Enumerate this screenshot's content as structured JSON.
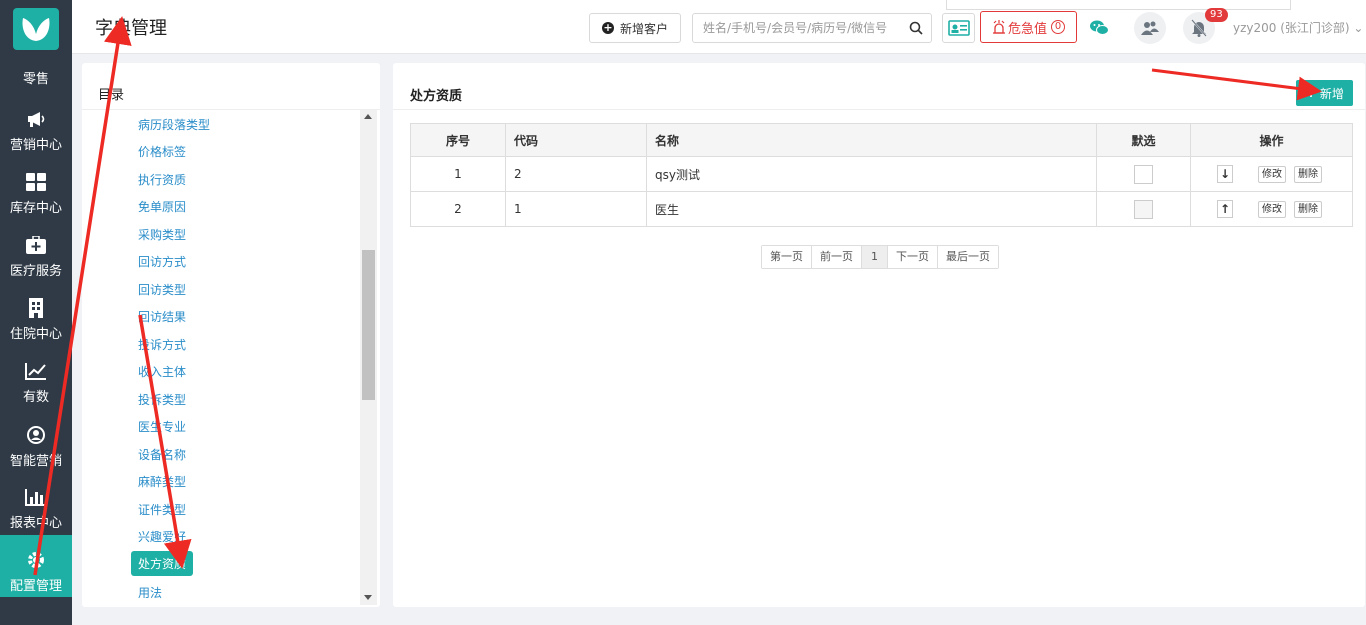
{
  "sidebar": {
    "items": [
      {
        "label": "零售",
        "icon": "retail-icon"
      },
      {
        "label": "营销中心",
        "icon": "megaphone-icon"
      },
      {
        "label": "库存中心",
        "icon": "grid-icon"
      },
      {
        "label": "医疗服务",
        "icon": "medical-kit-icon"
      },
      {
        "label": "住院中心",
        "icon": "hospital-icon"
      },
      {
        "label": "有数",
        "icon": "trend-icon"
      },
      {
        "label": "智能营销",
        "icon": "smart-marketing-icon"
      },
      {
        "label": "报表中心",
        "icon": "bar-chart-icon"
      },
      {
        "label": "配置管理",
        "icon": "gear-icon",
        "active": true
      }
    ]
  },
  "header": {
    "title": "字典管理",
    "new_customer_label": "新增客户",
    "search_placeholder": "姓名/手机号/会员号/病历号/微信号",
    "critical_label": "危急值",
    "critical_count": "0",
    "notification_badge": "93",
    "user": "yzy200 (张江门诊部)"
  },
  "left": {
    "title": "目录",
    "items": [
      "病历段落类型",
      "价格标签",
      "执行资质",
      "免单原因",
      "采购类型",
      "回访方式",
      "回访类型",
      "回访结果",
      "投诉方式",
      "收入主体",
      "投诉类型",
      "医生专业",
      "设备名称",
      "麻醉类型",
      "证件类型",
      "兴趣爱好",
      "处方资质",
      "用法"
    ],
    "active_index": 16
  },
  "main": {
    "title": "处方资质",
    "add_label": "新增",
    "columns": [
      "序号",
      "代码",
      "名称",
      "默选",
      "操作"
    ],
    "rows": [
      {
        "seq": "1",
        "code": "2",
        "name": "qsy测试",
        "arrow": "↓",
        "edit": "修改",
        "del": "删除"
      },
      {
        "seq": "2",
        "code": "1",
        "name": "医生",
        "arrow": "↑",
        "edit": "修改",
        "del": "删除"
      }
    ],
    "pager": {
      "first": "第一页",
      "prev": "前一页",
      "current": "1",
      "next": "下一页",
      "last": "最后一页"
    }
  },
  "colors": {
    "accent": "#1fb0a5",
    "sidebar": "#2f3a46",
    "danger": "#e23a3a",
    "link": "#2a8dc9",
    "annotation": "#ee2a24"
  }
}
